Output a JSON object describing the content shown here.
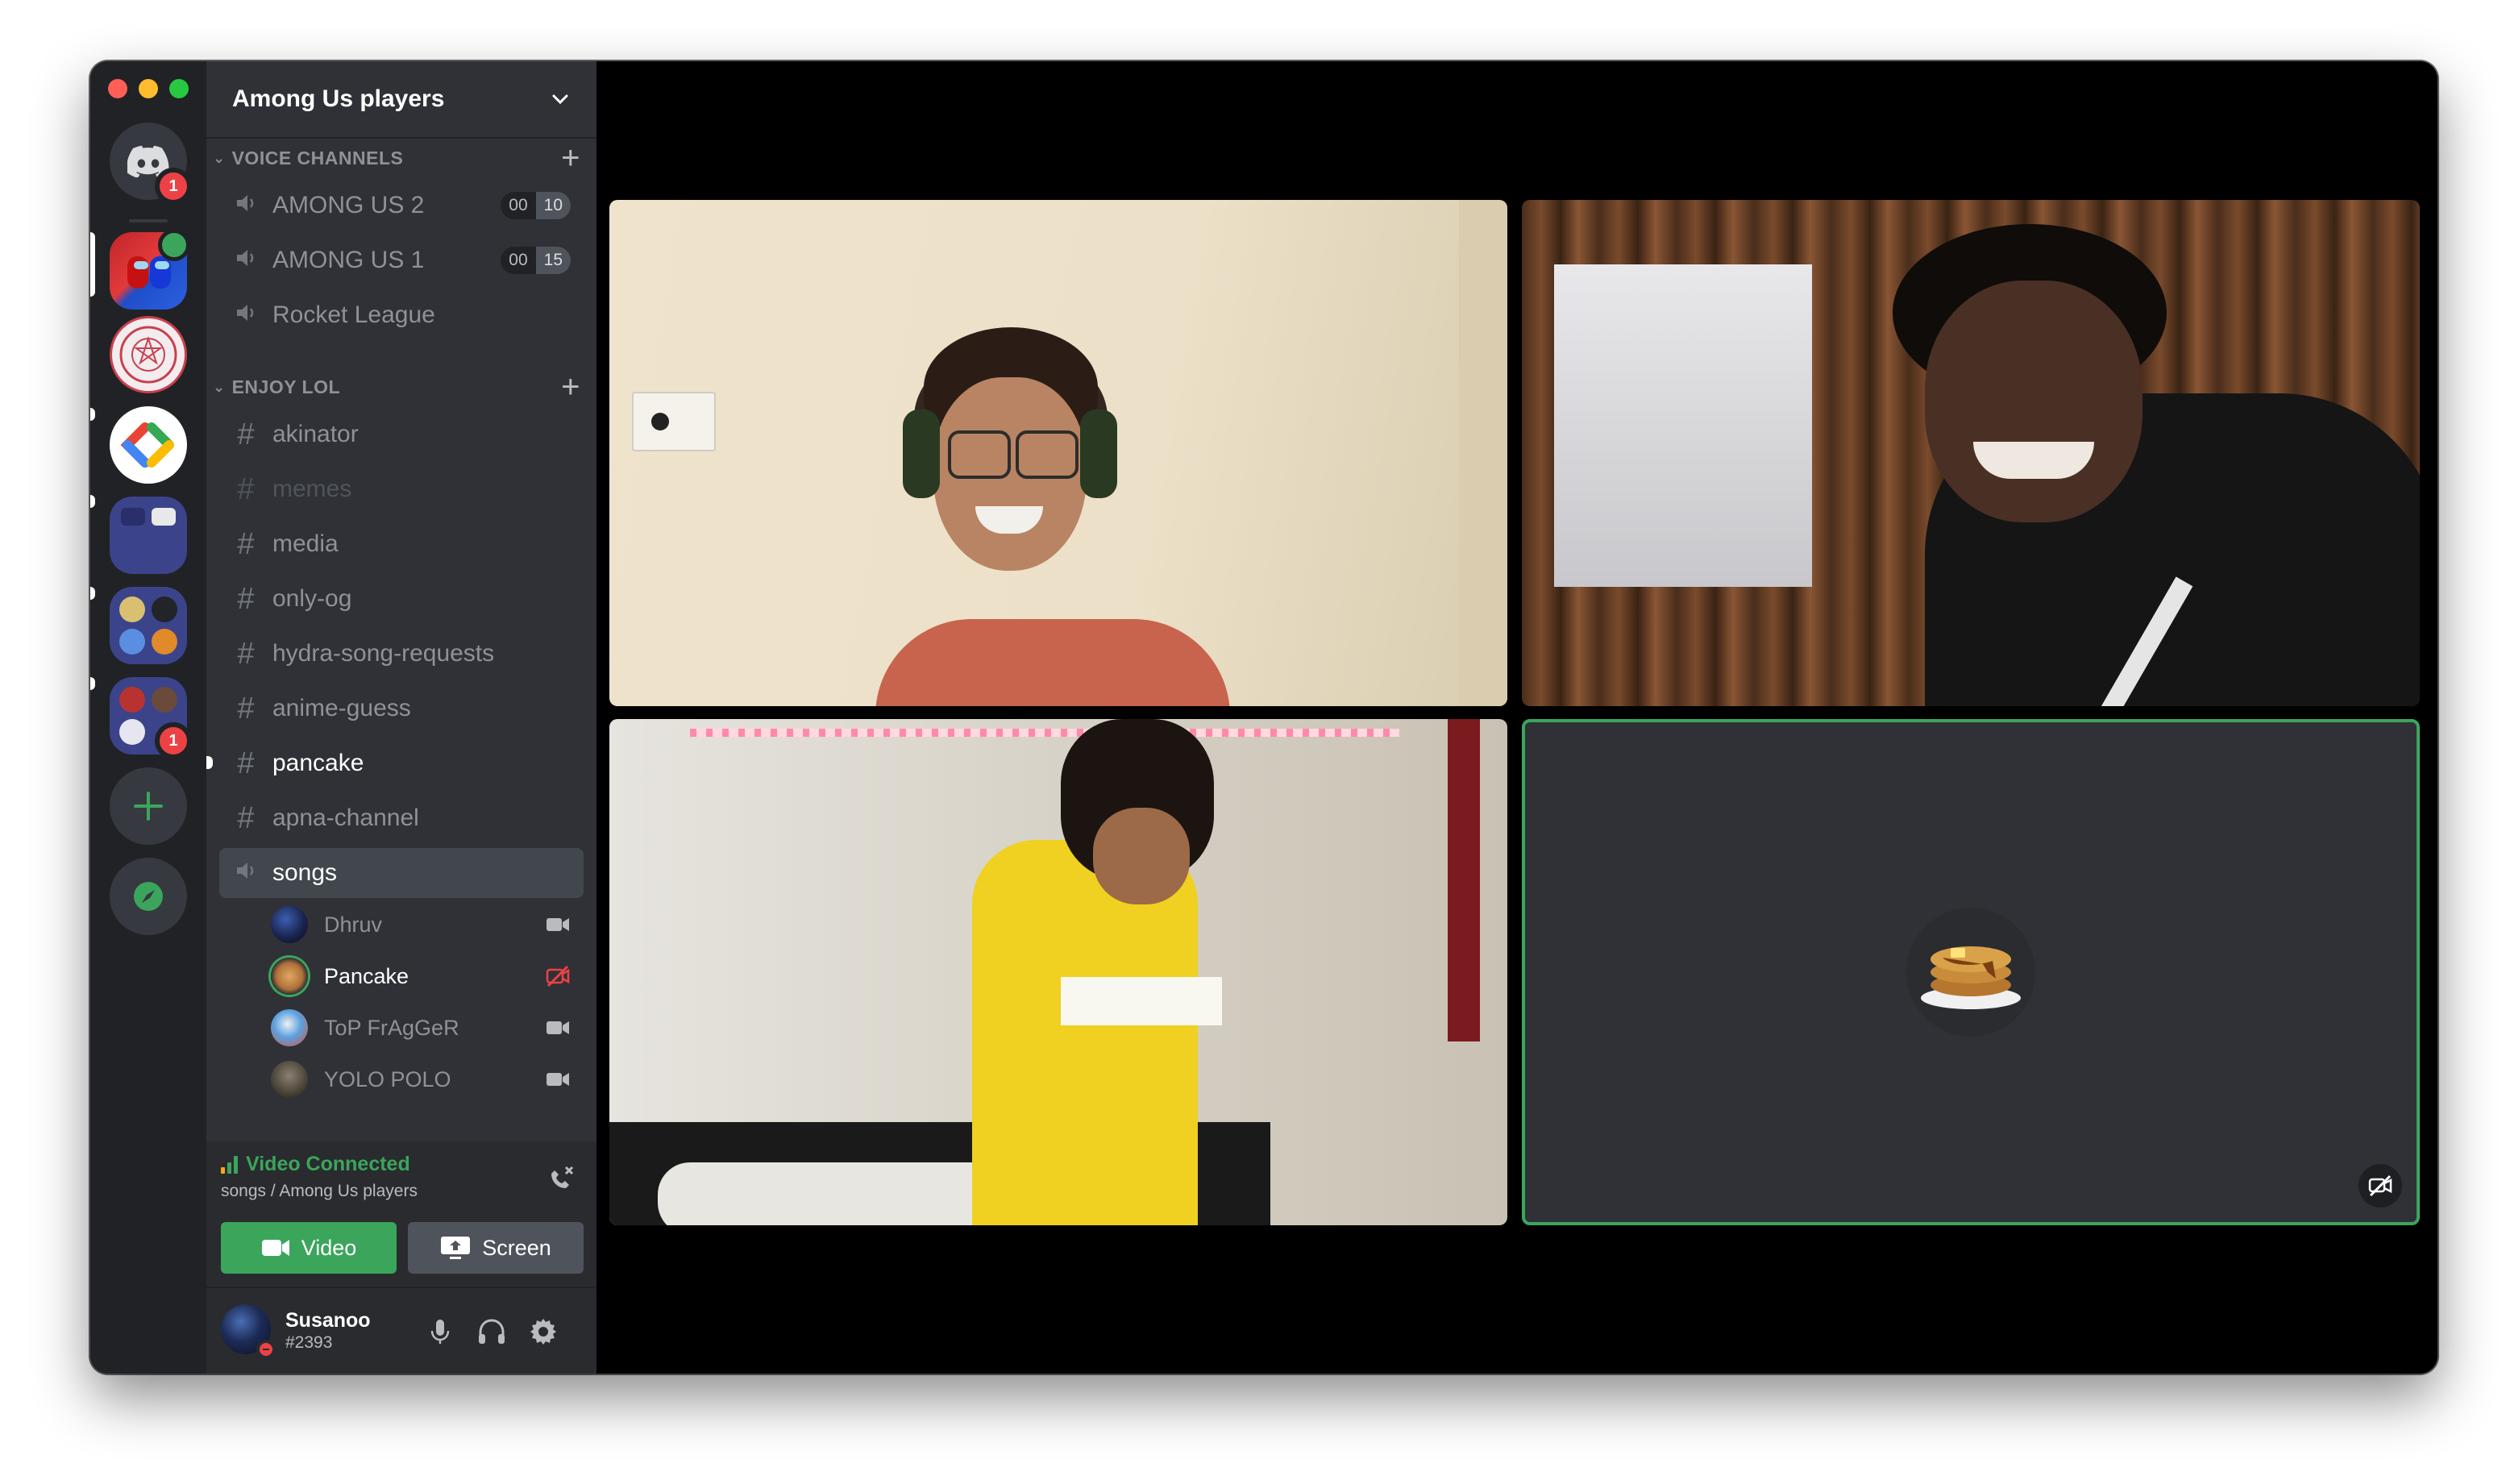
{
  "server": {
    "name": "Among Us players"
  },
  "rail": {
    "home_badge": "1",
    "last_badge": "1"
  },
  "categories": [
    {
      "label": "VOICE CHANNELS"
    },
    {
      "label": "ENJOY LOL"
    }
  ],
  "voice_channels": [
    {
      "name": "AMONG US 2",
      "count_a": "00",
      "count_b": "10"
    },
    {
      "name": "AMONG US 1",
      "count_a": "00",
      "count_b": "15"
    },
    {
      "name": "Rocket League"
    }
  ],
  "text_channels": [
    {
      "name": "akinator"
    },
    {
      "name": "memes"
    },
    {
      "name": "media"
    },
    {
      "name": "only-og"
    },
    {
      "name": "hydra-song-requests"
    },
    {
      "name": "anime-guess"
    },
    {
      "name": "pancake"
    },
    {
      "name": "apna-channel"
    }
  ],
  "active_voice": {
    "name": "songs",
    "users": [
      {
        "name": "Dhruv",
        "status_icon": "video-icon"
      },
      {
        "name": "Pancake",
        "status_icon": "video-off-icon"
      },
      {
        "name": "ToP FrAgGeR",
        "status_icon": "video-icon"
      },
      {
        "name": "YOLO POLO",
        "status_icon": "video-icon"
      }
    ]
  },
  "voice_panel": {
    "status": "Video Connected",
    "subtitle": "songs / Among Us players",
    "video_label": "Video",
    "screen_label": "Screen"
  },
  "user": {
    "name": "Susanoo",
    "tag": "#2393"
  },
  "colors": {
    "green": "#3ba55c",
    "red": "#ed4245",
    "sidebar": "#2f3136",
    "rail": "#202225"
  }
}
